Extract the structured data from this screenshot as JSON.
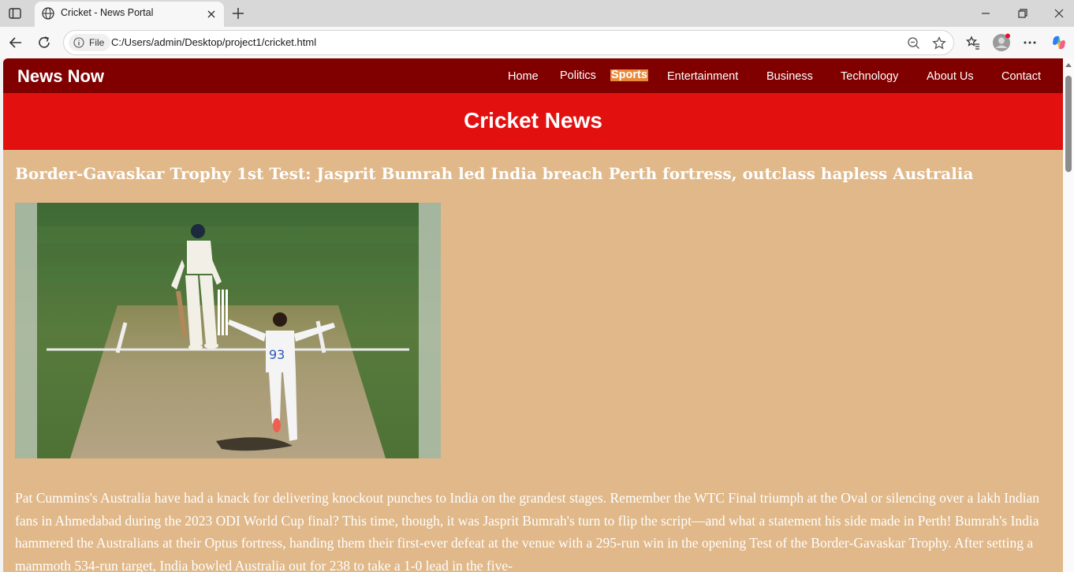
{
  "browser": {
    "tab_title": "Cricket - News Portal",
    "site_info_label": "File",
    "url": "C:/Users/admin/Desktop/project1/cricket.html"
  },
  "site": {
    "brand": "News Now",
    "nav": [
      {
        "label": "Home",
        "active": false
      },
      {
        "label": "Politics",
        "active": false
      },
      {
        "label": "Sports",
        "active": true
      },
      {
        "label": "Entertainment",
        "active": false
      },
      {
        "label": "Business",
        "active": false
      },
      {
        "label": "Technology",
        "active": false
      },
      {
        "label": "About Us",
        "active": false
      },
      {
        "label": "Contact",
        "active": false
      }
    ],
    "page_heading": "Cricket News"
  },
  "article": {
    "headline": "Border-Gavaskar Trophy 1st Test: Jasprit Bumrah led India breach Perth fortress, outclass hapless Australia",
    "photo_jersey_number": "93",
    "body": "Pat Cummins's Australia have had a knack for delivering knockout punches to India on the grandest stages. Remember the WTC Final triumph at the Oval or silencing over a lakh Indian fans in Ahmedabad during the 2023 ODI World Cup final? This time, though, it was Jasprit Bumrah's turn to flip the script—and what a statement his side made in Perth! Bumrah's India hammered the Australians at their Optus fortress, handing them their first-ever defeat at the venue with a 295-run win in the opening Test of the Border-Gavaskar Trophy. After setting a mammoth 534-run target, India bowled Australia out for 238 to take a 1-0 lead in the five-"
  },
  "colors": {
    "navbar": "#800000",
    "banner": "#e31010",
    "page_bg": "#e0b889",
    "active_nav": "#e88a3a"
  }
}
